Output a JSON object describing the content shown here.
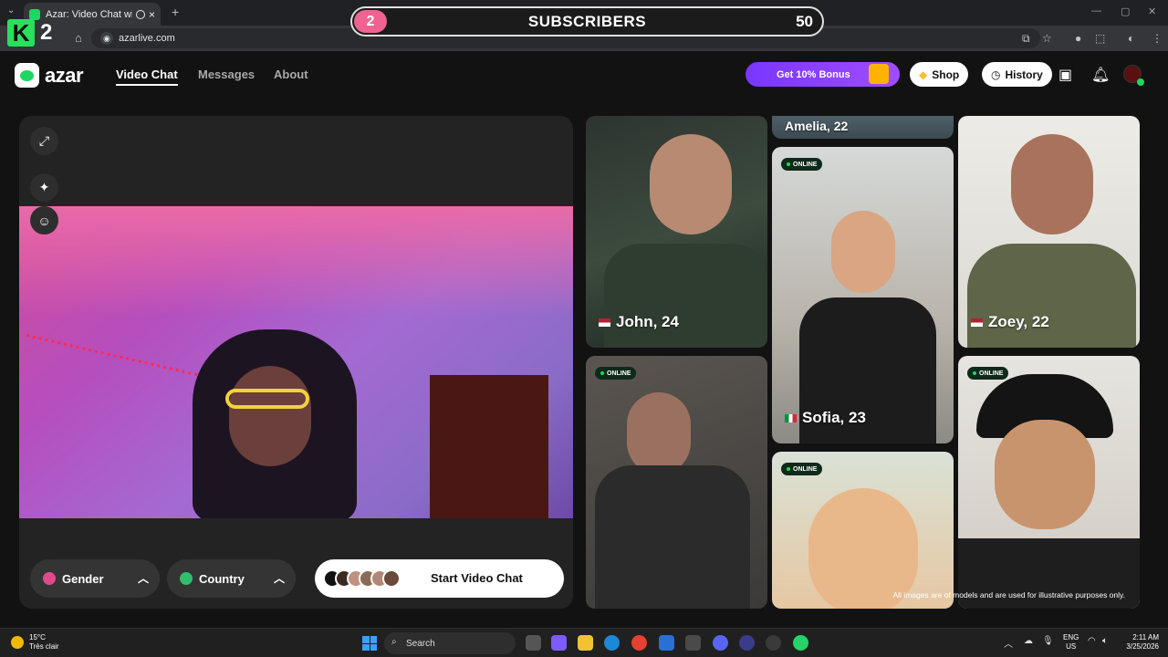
{
  "browser": {
    "tab_title": "Azar: Video Chat with New",
    "url": "azarlive.com",
    "new_tab_icon": "+",
    "close_icon": "×"
  },
  "overlay": {
    "k_letter": "K",
    "k_number": "2",
    "sub_level": "2",
    "sub_label": "SUBSCRIBERS",
    "sub_count": "50"
  },
  "header": {
    "logo_text": "azar",
    "nav": [
      "Video Chat",
      "Messages",
      "About"
    ],
    "bonus_label": "Get 10% Bonus",
    "shop_label": "Shop",
    "history_label": "History"
  },
  "video": {
    "gender_label": "Gender",
    "country_label": "Country",
    "start_label": "Start Video Chat"
  },
  "gallery": {
    "cards": [
      {
        "name": "Amelia, 22"
      },
      {
        "name": "John, 24"
      },
      {
        "name": "Zoey, 22"
      },
      {
        "name": "Sofia, 23"
      },
      {
        "name": ""
      },
      {
        "name": ""
      },
      {
        "name": ""
      }
    ],
    "online_label": "ONLINE",
    "disclaimer": "All images are of models and are used for illustrative purposes only."
  },
  "taskbar": {
    "weather_temp": "15°C",
    "weather_desc": "Très clair",
    "search_label": "Search",
    "lang_top": "ENG",
    "lang_bottom": "US",
    "time": "2:11 AM",
    "date": "3/25/2026"
  },
  "colors": {
    "accent_green": "#1ed760",
    "bonus_purple": "#7a36ff",
    "online_green": "#1ed760"
  }
}
